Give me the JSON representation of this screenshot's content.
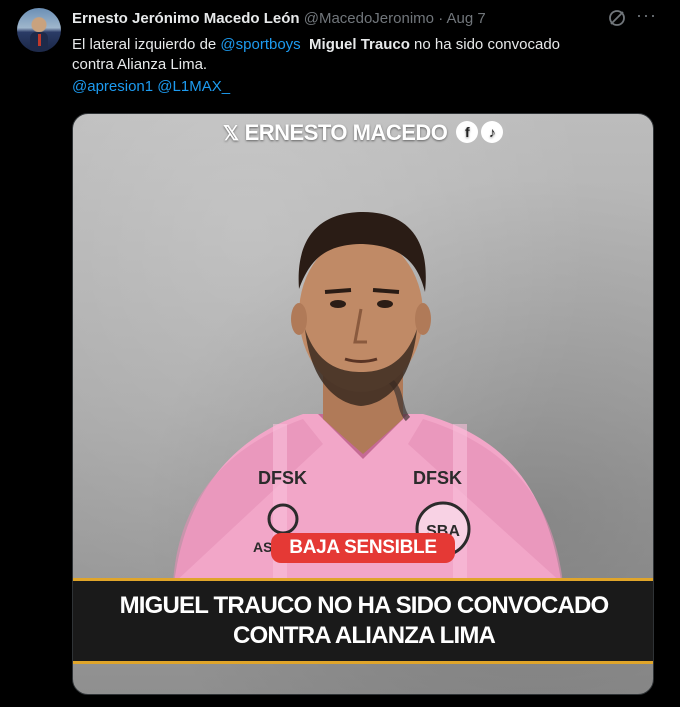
{
  "tweet": {
    "display_name": "Ernesto Jerónimo Macedo León",
    "handle": "@MacedoJeronimo",
    "separator": "·",
    "date": "Aug 7",
    "text_part1": "El lateral izquierdo de ",
    "mention_club": "@sportboys",
    "text_bold": "Miguel Trauco",
    "text_part2": " no ha sido convocado",
    "text_line2": "contra Alianza Lima.",
    "mention_1": "@apresion1",
    "mention_2": "@L1MAX_"
  },
  "icons": {
    "grok": "grok-icon",
    "more": "more-icon",
    "brand_x": "x-icon",
    "facebook": "facebook-icon",
    "tiktok": "tiktok-icon"
  },
  "media": {
    "brand_name": "ERNESTO MACEDO",
    "badge": "BAJA SENSIBLE",
    "banner_line1": "MIGUEL TRAUCO NO HA SIDO CONVOCADO",
    "banner_line2": "CONTRA ALIANZA LIMA",
    "shirt_sponsor_left": "DFSK",
    "shirt_sponsor_right": "DFSK",
    "crest": "SBA",
    "shirt_brand": "AST"
  },
  "colors": {
    "background": "#000000",
    "text": "#e7e9ea",
    "muted": "#71767b",
    "link": "#1d9bf0",
    "badge": "#e53935",
    "banner_border": "#e0a52a",
    "shirt": "#f2a6c8"
  }
}
